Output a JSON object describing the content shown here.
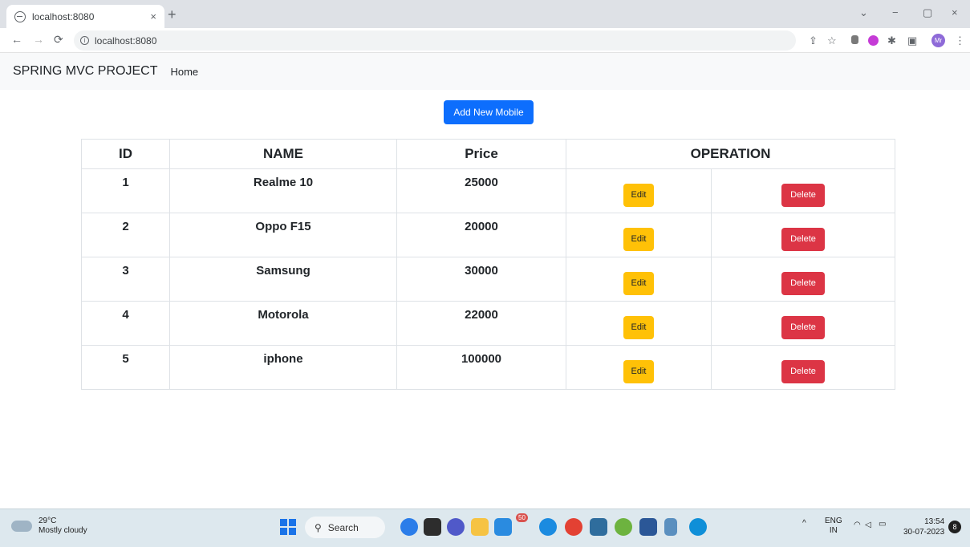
{
  "browser": {
    "tab_title": "localhost:8080",
    "tab_close": "×",
    "new_tab": "+",
    "url": "localhost:8080",
    "controls": {
      "dropdown": "⌄",
      "minimize": "−",
      "restore": "▢",
      "close": "×"
    },
    "profile_initials": "Mr"
  },
  "navbar": {
    "brand": "SPRING MVC PROJECT",
    "home": "Home"
  },
  "add_button": "Add New Mobile",
  "table": {
    "headers": {
      "id": "ID",
      "name": "NAME",
      "price": "Price",
      "operation": "OPERATION"
    },
    "edit_label": "Edit",
    "delete_label": "Delete",
    "rows": [
      {
        "id": "1",
        "name": "Realme 10",
        "price": "25000"
      },
      {
        "id": "2",
        "name": "Oppo F15",
        "price": "20000"
      },
      {
        "id": "3",
        "name": "Samsung",
        "price": "30000"
      },
      {
        "id": "4",
        "name": "Motorola",
        "price": "22000"
      },
      {
        "id": "5",
        "name": "iphone",
        "price": "100000"
      }
    ]
  },
  "taskbar": {
    "temperature": "29°C",
    "weather": "Mostly cloudy",
    "search": "Search",
    "lang_top": "ENG",
    "lang_bottom": "IN",
    "time": "13:54",
    "date": "30-07-2023",
    "notifications": "8",
    "badge_count": "50"
  },
  "colors": {
    "primary": "#0d6efd",
    "warning": "#ffc107",
    "danger": "#dc3545",
    "navbar_bg": "#f8f9fa"
  }
}
